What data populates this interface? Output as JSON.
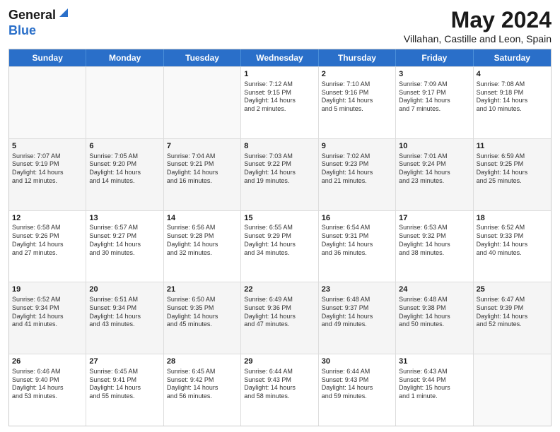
{
  "header": {
    "logo_general": "General",
    "logo_blue": "Blue",
    "title": "May 2024",
    "location": "Villahan, Castille and Leon, Spain"
  },
  "calendar": {
    "days": [
      "Sunday",
      "Monday",
      "Tuesday",
      "Wednesday",
      "Thursday",
      "Friday",
      "Saturday"
    ],
    "rows": [
      [
        {
          "day": "",
          "lines": []
        },
        {
          "day": "",
          "lines": []
        },
        {
          "day": "",
          "lines": []
        },
        {
          "day": "1",
          "lines": [
            "Sunrise: 7:12 AM",
            "Sunset: 9:15 PM",
            "Daylight: 14 hours",
            "and 2 minutes."
          ]
        },
        {
          "day": "2",
          "lines": [
            "Sunrise: 7:10 AM",
            "Sunset: 9:16 PM",
            "Daylight: 14 hours",
            "and 5 minutes."
          ]
        },
        {
          "day": "3",
          "lines": [
            "Sunrise: 7:09 AM",
            "Sunset: 9:17 PM",
            "Daylight: 14 hours",
            "and 7 minutes."
          ]
        },
        {
          "day": "4",
          "lines": [
            "Sunrise: 7:08 AM",
            "Sunset: 9:18 PM",
            "Daylight: 14 hours",
            "and 10 minutes."
          ]
        }
      ],
      [
        {
          "day": "5",
          "lines": [
            "Sunrise: 7:07 AM",
            "Sunset: 9:19 PM",
            "Daylight: 14 hours",
            "and 12 minutes."
          ]
        },
        {
          "day": "6",
          "lines": [
            "Sunrise: 7:05 AM",
            "Sunset: 9:20 PM",
            "Daylight: 14 hours",
            "and 14 minutes."
          ]
        },
        {
          "day": "7",
          "lines": [
            "Sunrise: 7:04 AM",
            "Sunset: 9:21 PM",
            "Daylight: 14 hours",
            "and 16 minutes."
          ]
        },
        {
          "day": "8",
          "lines": [
            "Sunrise: 7:03 AM",
            "Sunset: 9:22 PM",
            "Daylight: 14 hours",
            "and 19 minutes."
          ]
        },
        {
          "day": "9",
          "lines": [
            "Sunrise: 7:02 AM",
            "Sunset: 9:23 PM",
            "Daylight: 14 hours",
            "and 21 minutes."
          ]
        },
        {
          "day": "10",
          "lines": [
            "Sunrise: 7:01 AM",
            "Sunset: 9:24 PM",
            "Daylight: 14 hours",
            "and 23 minutes."
          ]
        },
        {
          "day": "11",
          "lines": [
            "Sunrise: 6:59 AM",
            "Sunset: 9:25 PM",
            "Daylight: 14 hours",
            "and 25 minutes."
          ]
        }
      ],
      [
        {
          "day": "12",
          "lines": [
            "Sunrise: 6:58 AM",
            "Sunset: 9:26 PM",
            "Daylight: 14 hours",
            "and 27 minutes."
          ]
        },
        {
          "day": "13",
          "lines": [
            "Sunrise: 6:57 AM",
            "Sunset: 9:27 PM",
            "Daylight: 14 hours",
            "and 30 minutes."
          ]
        },
        {
          "day": "14",
          "lines": [
            "Sunrise: 6:56 AM",
            "Sunset: 9:28 PM",
            "Daylight: 14 hours",
            "and 32 minutes."
          ]
        },
        {
          "day": "15",
          "lines": [
            "Sunrise: 6:55 AM",
            "Sunset: 9:29 PM",
            "Daylight: 14 hours",
            "and 34 minutes."
          ]
        },
        {
          "day": "16",
          "lines": [
            "Sunrise: 6:54 AM",
            "Sunset: 9:31 PM",
            "Daylight: 14 hours",
            "and 36 minutes."
          ]
        },
        {
          "day": "17",
          "lines": [
            "Sunrise: 6:53 AM",
            "Sunset: 9:32 PM",
            "Daylight: 14 hours",
            "and 38 minutes."
          ]
        },
        {
          "day": "18",
          "lines": [
            "Sunrise: 6:52 AM",
            "Sunset: 9:33 PM",
            "Daylight: 14 hours",
            "and 40 minutes."
          ]
        }
      ],
      [
        {
          "day": "19",
          "lines": [
            "Sunrise: 6:52 AM",
            "Sunset: 9:34 PM",
            "Daylight: 14 hours",
            "and 41 minutes."
          ]
        },
        {
          "day": "20",
          "lines": [
            "Sunrise: 6:51 AM",
            "Sunset: 9:34 PM",
            "Daylight: 14 hours",
            "and 43 minutes."
          ]
        },
        {
          "day": "21",
          "lines": [
            "Sunrise: 6:50 AM",
            "Sunset: 9:35 PM",
            "Daylight: 14 hours",
            "and 45 minutes."
          ]
        },
        {
          "day": "22",
          "lines": [
            "Sunrise: 6:49 AM",
            "Sunset: 9:36 PM",
            "Daylight: 14 hours",
            "and 47 minutes."
          ]
        },
        {
          "day": "23",
          "lines": [
            "Sunrise: 6:48 AM",
            "Sunset: 9:37 PM",
            "Daylight: 14 hours",
            "and 49 minutes."
          ]
        },
        {
          "day": "24",
          "lines": [
            "Sunrise: 6:48 AM",
            "Sunset: 9:38 PM",
            "Daylight: 14 hours",
            "and 50 minutes."
          ]
        },
        {
          "day": "25",
          "lines": [
            "Sunrise: 6:47 AM",
            "Sunset: 9:39 PM",
            "Daylight: 14 hours",
            "and 52 minutes."
          ]
        }
      ],
      [
        {
          "day": "26",
          "lines": [
            "Sunrise: 6:46 AM",
            "Sunset: 9:40 PM",
            "Daylight: 14 hours",
            "and 53 minutes."
          ]
        },
        {
          "day": "27",
          "lines": [
            "Sunrise: 6:45 AM",
            "Sunset: 9:41 PM",
            "Daylight: 14 hours",
            "and 55 minutes."
          ]
        },
        {
          "day": "28",
          "lines": [
            "Sunrise: 6:45 AM",
            "Sunset: 9:42 PM",
            "Daylight: 14 hours",
            "and 56 minutes."
          ]
        },
        {
          "day": "29",
          "lines": [
            "Sunrise: 6:44 AM",
            "Sunset: 9:43 PM",
            "Daylight: 14 hours",
            "and 58 minutes."
          ]
        },
        {
          "day": "30",
          "lines": [
            "Sunrise: 6:44 AM",
            "Sunset: 9:43 PM",
            "Daylight: 14 hours",
            "and 59 minutes."
          ]
        },
        {
          "day": "31",
          "lines": [
            "Sunrise: 6:43 AM",
            "Sunset: 9:44 PM",
            "Daylight: 15 hours",
            "and 1 minute."
          ]
        },
        {
          "day": "",
          "lines": []
        }
      ]
    ]
  }
}
